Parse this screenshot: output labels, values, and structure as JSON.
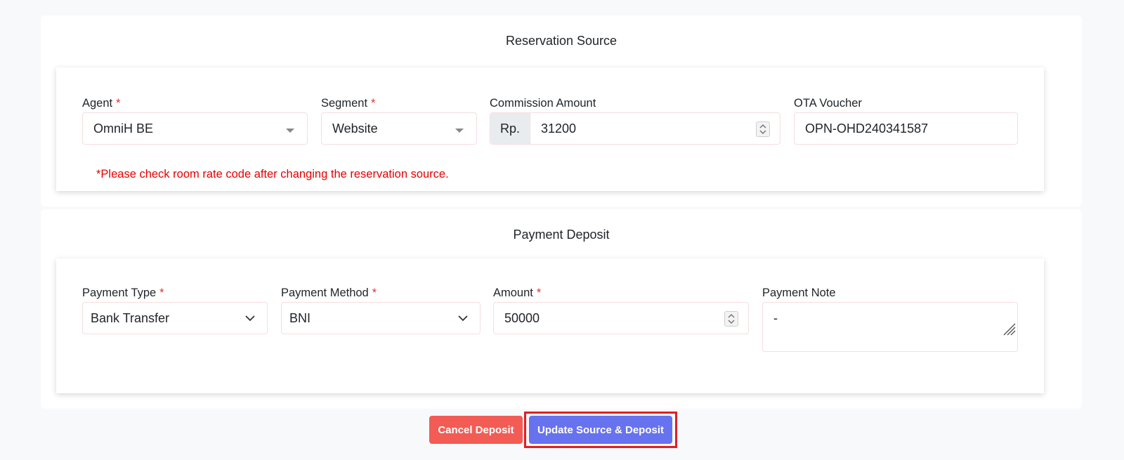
{
  "reservation_source": {
    "title": "Reservation Source",
    "agent": {
      "label": "Agent",
      "required_mark": "*",
      "value": "OmniH BE"
    },
    "segment": {
      "label": "Segment",
      "required_mark": "*",
      "value": "Website"
    },
    "commission": {
      "label": "Commission Amount",
      "prefix": "Rp.",
      "value": "31200"
    },
    "ota_voucher": {
      "label": "OTA Voucher",
      "value": "OPN-OHD240341587"
    },
    "note": "*Please check room rate code after changing the reservation source."
  },
  "payment_deposit": {
    "title": "Payment Deposit",
    "payment_type": {
      "label": "Payment Type",
      "required_mark": "*",
      "value": "Bank Transfer"
    },
    "payment_method": {
      "label": "Payment Method",
      "required_mark": "*",
      "value": "BNI"
    },
    "amount": {
      "label": "Amount",
      "required_mark": "*",
      "value": "50000"
    },
    "payment_note": {
      "label": "Payment Note",
      "value": "-"
    }
  },
  "actions": {
    "cancel_label": "Cancel Deposit",
    "update_label": "Update Source & Deposit"
  },
  "colors": {
    "cancel": "#f25c54",
    "update": "#6772ef",
    "required": "#e3342f",
    "highlight": "#e31e24"
  }
}
